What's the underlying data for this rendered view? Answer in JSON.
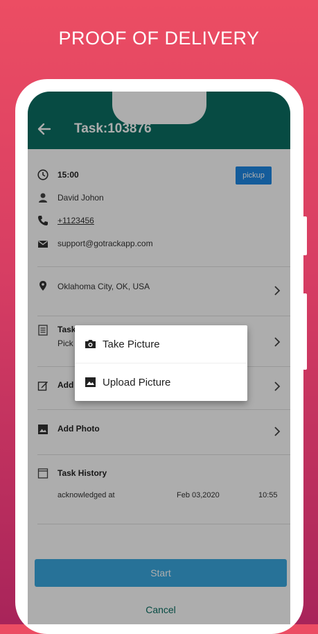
{
  "headline": "PROOF OF DELIVERY",
  "appbar": {
    "title": "Task:103876"
  },
  "task": {
    "time": "15:00",
    "type_badge": "pickup",
    "customer_name": "David Johon",
    "phone": "+1123456",
    "email": "support@gotrackapp.com",
    "address": "Oklahoma City, OK, USA",
    "task_label": "Task",
    "task_sub": "Pick"
  },
  "sections": {
    "add_note": "Add",
    "add_photo": "Add Photo",
    "task_history": "Task History"
  },
  "history": [
    {
      "status": "acknowledged at",
      "date": "Feb 03,2020",
      "time": "10:55"
    }
  ],
  "buttons": {
    "start": "Start",
    "cancel": "Cancel"
  },
  "dialog": {
    "items": [
      {
        "label": "Take Picture",
        "icon": "camera-icon"
      },
      {
        "label": "Upload Picture",
        "icon": "image-icon"
      }
    ]
  },
  "colors": {
    "appbar": "#0b6f63",
    "accent": "#1e88e5",
    "start": "#3aa9e0"
  }
}
